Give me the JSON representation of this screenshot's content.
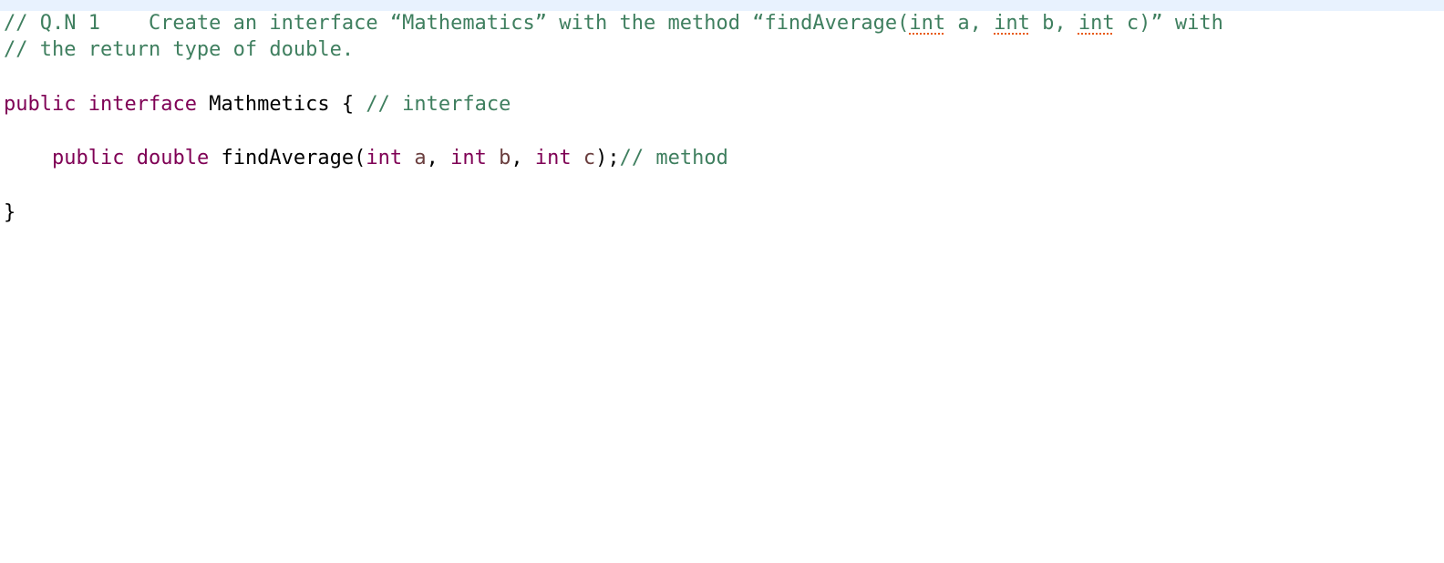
{
  "editor": {
    "comment_line1": {
      "prefix": "// Q.N 1    Create an interface “Mathematics” with the method “findAverage(",
      "int1": "int",
      "mid1": " a, ",
      "int2": "int",
      "mid2": " b, ",
      "int3": "int",
      "suffix": " c)” with"
    },
    "comment_line2": "// the return type of double.",
    "interface_line": {
      "kw_public": "public",
      "kw_interface": "interface",
      "name": " Mathmetics { ",
      "comment": "// interface"
    },
    "method_line": {
      "indent": "    ",
      "kw_public": "public",
      "kw_double": "double",
      "method_name": " findAverage(",
      "int1": "int",
      "param_a": "a",
      "sep1": ", ",
      "int2": "int",
      "param_b": "b",
      "sep2": ", ",
      "int3": "int",
      "param_c": "c",
      "close": ");",
      "comment": "// method"
    },
    "closing_brace": "}"
  },
  "colors": {
    "comment": "#3f7f5f",
    "keyword": "#7f0055",
    "parameter": "#6a3e3e",
    "text": "#000000",
    "current_line": "#e8f2fe",
    "spell_squiggle": "#e8590c"
  }
}
